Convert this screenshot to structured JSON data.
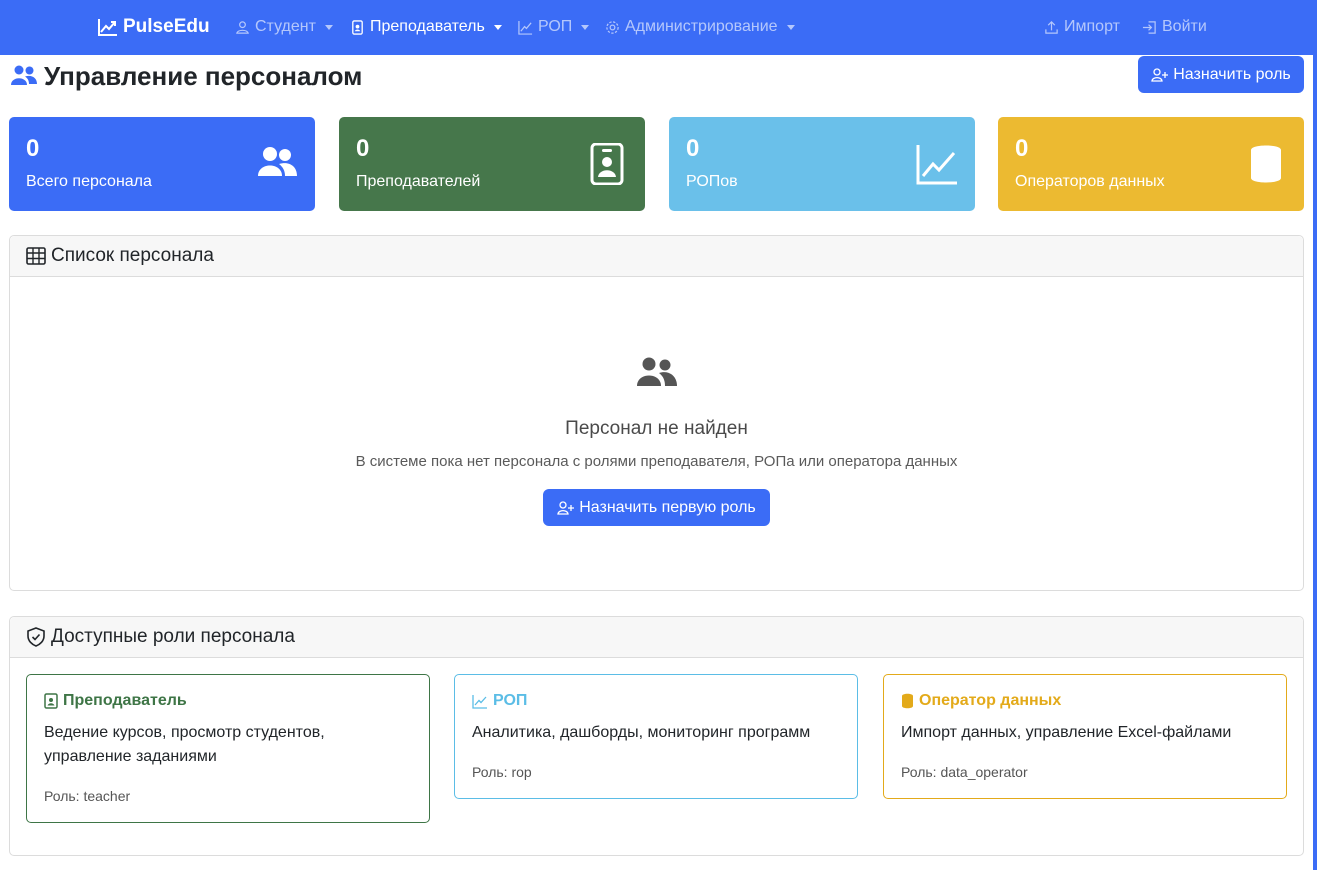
{
  "nav": {
    "brand": "PulseEdu",
    "items": [
      {
        "label": "Студент",
        "icon": "person-icon",
        "active": false
      },
      {
        "label": "Преподаватель",
        "icon": "badge-icon",
        "active": true
      },
      {
        "label": "РОП",
        "icon": "graph-icon",
        "active": false
      },
      {
        "label": "Администрирование",
        "icon": "gear-icon",
        "active": false
      }
    ],
    "import_label": "Импорт",
    "login_label": "Войти"
  },
  "header": {
    "title": "Управление персоналом",
    "assign_button": "Назначить роль"
  },
  "stats": [
    {
      "value": "0",
      "label": "Всего персонала",
      "color": "#3b6cf6",
      "icon": "people-icon"
    },
    {
      "value": "0",
      "label": "Преподавателей",
      "color": "#46774b",
      "icon": "badge-icon"
    },
    {
      "value": "0",
      "label": "РОПов",
      "color": "#6ac0ea",
      "icon": "graph-icon"
    },
    {
      "value": "0",
      "label": "Операторов данных",
      "color": "#ecba31",
      "icon": "database-icon"
    }
  ],
  "staff_list": {
    "title": "Список персонала",
    "empty_title": "Персонал не найден",
    "empty_text": "В системе пока нет персонала с ролями преподавателя, РОПа или оператора данных",
    "first_button": "Назначить первую роль"
  },
  "roles": {
    "title": "Доступные роли персонала",
    "items": [
      {
        "name": "Преподаватель",
        "desc": "Ведение курсов, просмотр студентов, управление заданиями",
        "note": "Роль: teacher",
        "color": "#3e7546"
      },
      {
        "name": "РОП",
        "desc": "Аналитика, дашборды, мониторинг программ",
        "note": "Роль: rop",
        "color": "#5bbde6"
      },
      {
        "name": "Оператор данных",
        "desc": "Импорт данных, управление Excel-файлами",
        "note": "Роль: data_operator",
        "color": "#e3aa1a"
      }
    ]
  }
}
